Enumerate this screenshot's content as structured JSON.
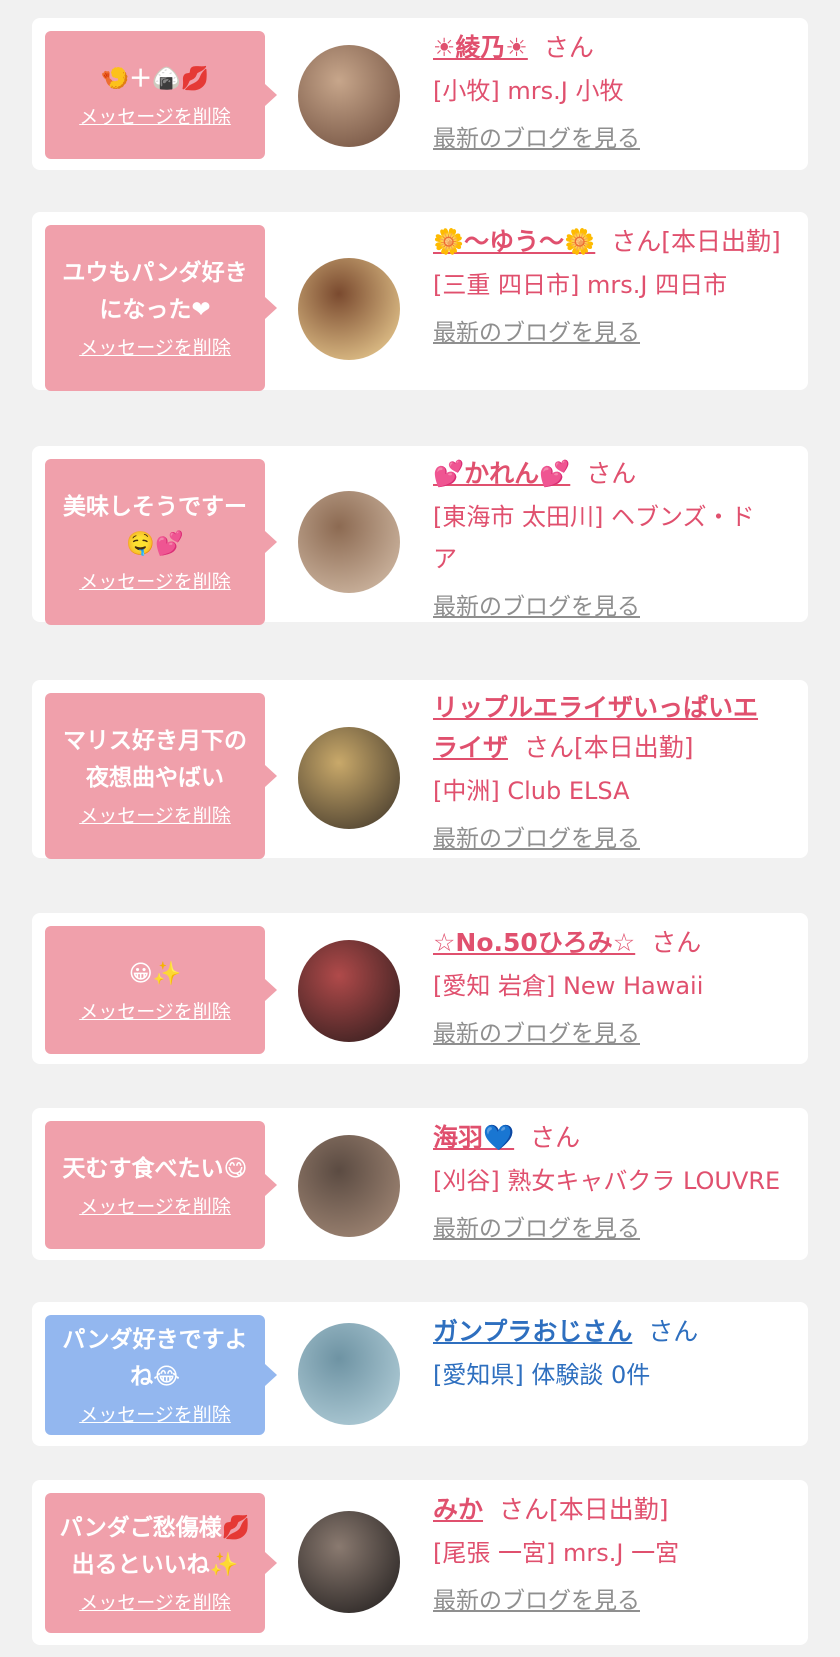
{
  "cards": [
    {
      "style": "pink",
      "msg": "🍤＋🍙💋",
      "delete": "メッセージを削除",
      "name": "☀綾乃☀",
      "suffix": "さん",
      "loc": "[小牧] mrs.J 小牧",
      "blog": "最新のブログを見る",
      "avatar": [
        "#6b4a3a",
        "#c7a68b"
      ]
    },
    {
      "style": "pink",
      "msg": "ユウもパンダ好きになった❤",
      "delete": "メッセージを削除",
      "name": "🌼〜ゆう〜🌼",
      "suffix": "さん[本日出勤]",
      "loc": "[三重 四日市] mrs.J 四日市",
      "blog": "最新のブログを見る",
      "avatar": [
        "#f4d89a",
        "#7a4a2f"
      ]
    },
    {
      "style": "pink",
      "msg": "美味しそうですー🤤💕",
      "delete": "メッセージを削除",
      "name": "💕かれん💕",
      "suffix": "さん",
      "loc": "[東海市 太田川] ヘブンズ・ドア",
      "blog": "最新のブログを見る",
      "avatar": [
        "#d8c2ad",
        "#8c6a52"
      ]
    },
    {
      "style": "pink",
      "msg": "マリス好き月下の夜想曲やばい",
      "delete": "メッセージを削除",
      "name": "リップルエライザいっぱいエライザ",
      "suffix": "さん[本日出勤]",
      "loc": "[中洲] Club ELSA",
      "blog": "最新のブログを見る",
      "avatar": [
        "#3a3127",
        "#c9a96a"
      ]
    },
    {
      "style": "pink",
      "msg": "😀✨",
      "delete": "メッセージを削除",
      "name": "☆No.50ひろみ☆",
      "suffix": "さん",
      "loc": "[愛知 岩倉] New Hawaii",
      "blog": "最新のブログを見る",
      "avatar": [
        "#2a1b1b",
        "#b04a4a"
      ]
    },
    {
      "style": "pink",
      "msg": "天むす食べたい😋",
      "delete": "メッセージを削除",
      "name": "海羽💙",
      "suffix": "さん",
      "loc": "[刈谷] 熟女キャバクラ LOUVRE",
      "blog": "最新のブログを見る",
      "avatar": [
        "#a98e7b",
        "#5b4b42"
      ]
    },
    {
      "style": "blue",
      "msg": "パンダ好きですよね😂",
      "delete": "メッセージを削除",
      "name": "ガンプラおじさん",
      "suffix": "さん",
      "loc": "[愛知県] 体験談 0件",
      "blog": "",
      "avatar": [
        "#b9d4de",
        "#6e93a3"
      ]
    },
    {
      "style": "pink",
      "msg": "パンダご愁傷様💋出るといいね✨",
      "delete": "メッセージを削除",
      "name": "みか",
      "suffix": "さん[本日出勤]",
      "loc": "[尾張 一宮] mrs.J 一宮",
      "blog": "最新のブログを見る",
      "avatar": [
        "#1d1a1a",
        "#8a7a70"
      ]
    }
  ]
}
